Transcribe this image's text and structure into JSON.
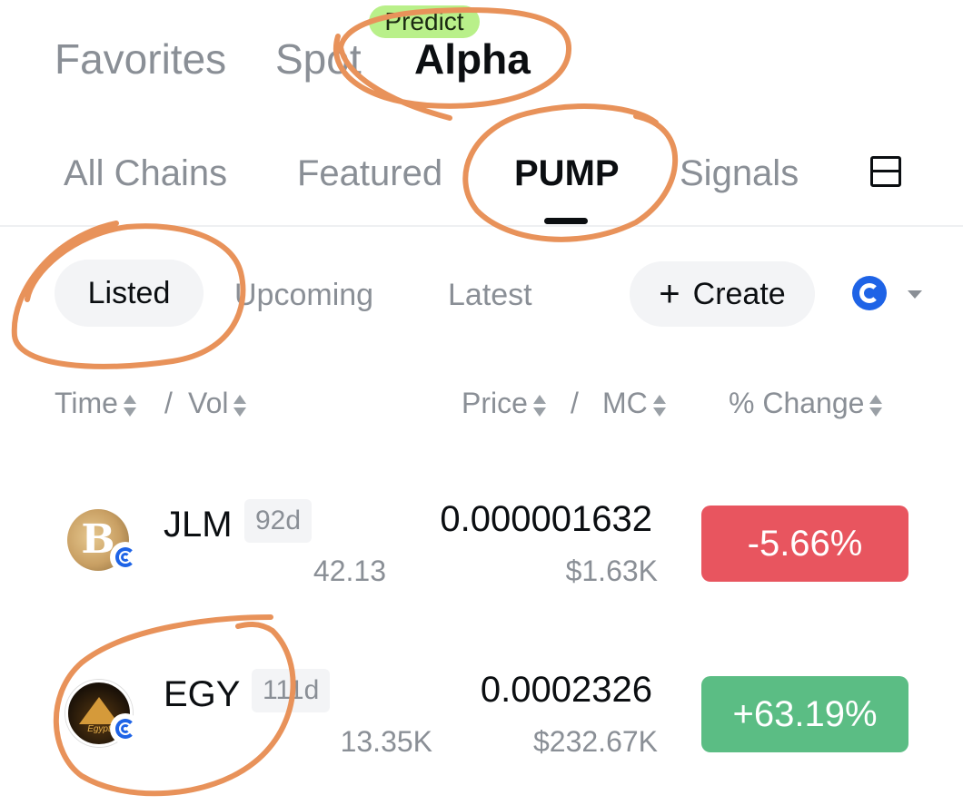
{
  "top_tabs": [
    {
      "label": "Favorites"
    },
    {
      "label": "Spot"
    },
    {
      "label": "Alpha",
      "badge": "Predict"
    }
  ],
  "chain_tabs": [
    {
      "label": "All Chains"
    },
    {
      "label": "Featured"
    },
    {
      "label": "PUMP"
    },
    {
      "label": "Signals"
    }
  ],
  "filters": {
    "listed": "Listed",
    "upcoming": "Upcoming",
    "latest": "Latest",
    "create_label": "Create",
    "chain_icon": "pump-chain-icon"
  },
  "columns": {
    "time": "Time",
    "vol": "Vol",
    "price": "Price",
    "mc": "MC",
    "change": "% Change",
    "sep": "/"
  },
  "rows": [
    {
      "symbol": "JLM",
      "age": "92d",
      "volume": "42.13",
      "price": "0.000001632",
      "market_cap": "$1.63K",
      "change": "-5.66%",
      "direction": "down"
    },
    {
      "symbol": "EGY",
      "age": "111d",
      "volume": "13.35K",
      "price": "0.0002326",
      "market_cap": "$232.67K",
      "change": "+63.19%",
      "direction": "up"
    }
  ],
  "colors": {
    "accent_dark": "#0b0e11",
    "muted": "#8a8f96",
    "up": "#5bbd84",
    "down": "#e8555f",
    "badge_green": "#b9f08a",
    "annotation": "#e8925a"
  }
}
